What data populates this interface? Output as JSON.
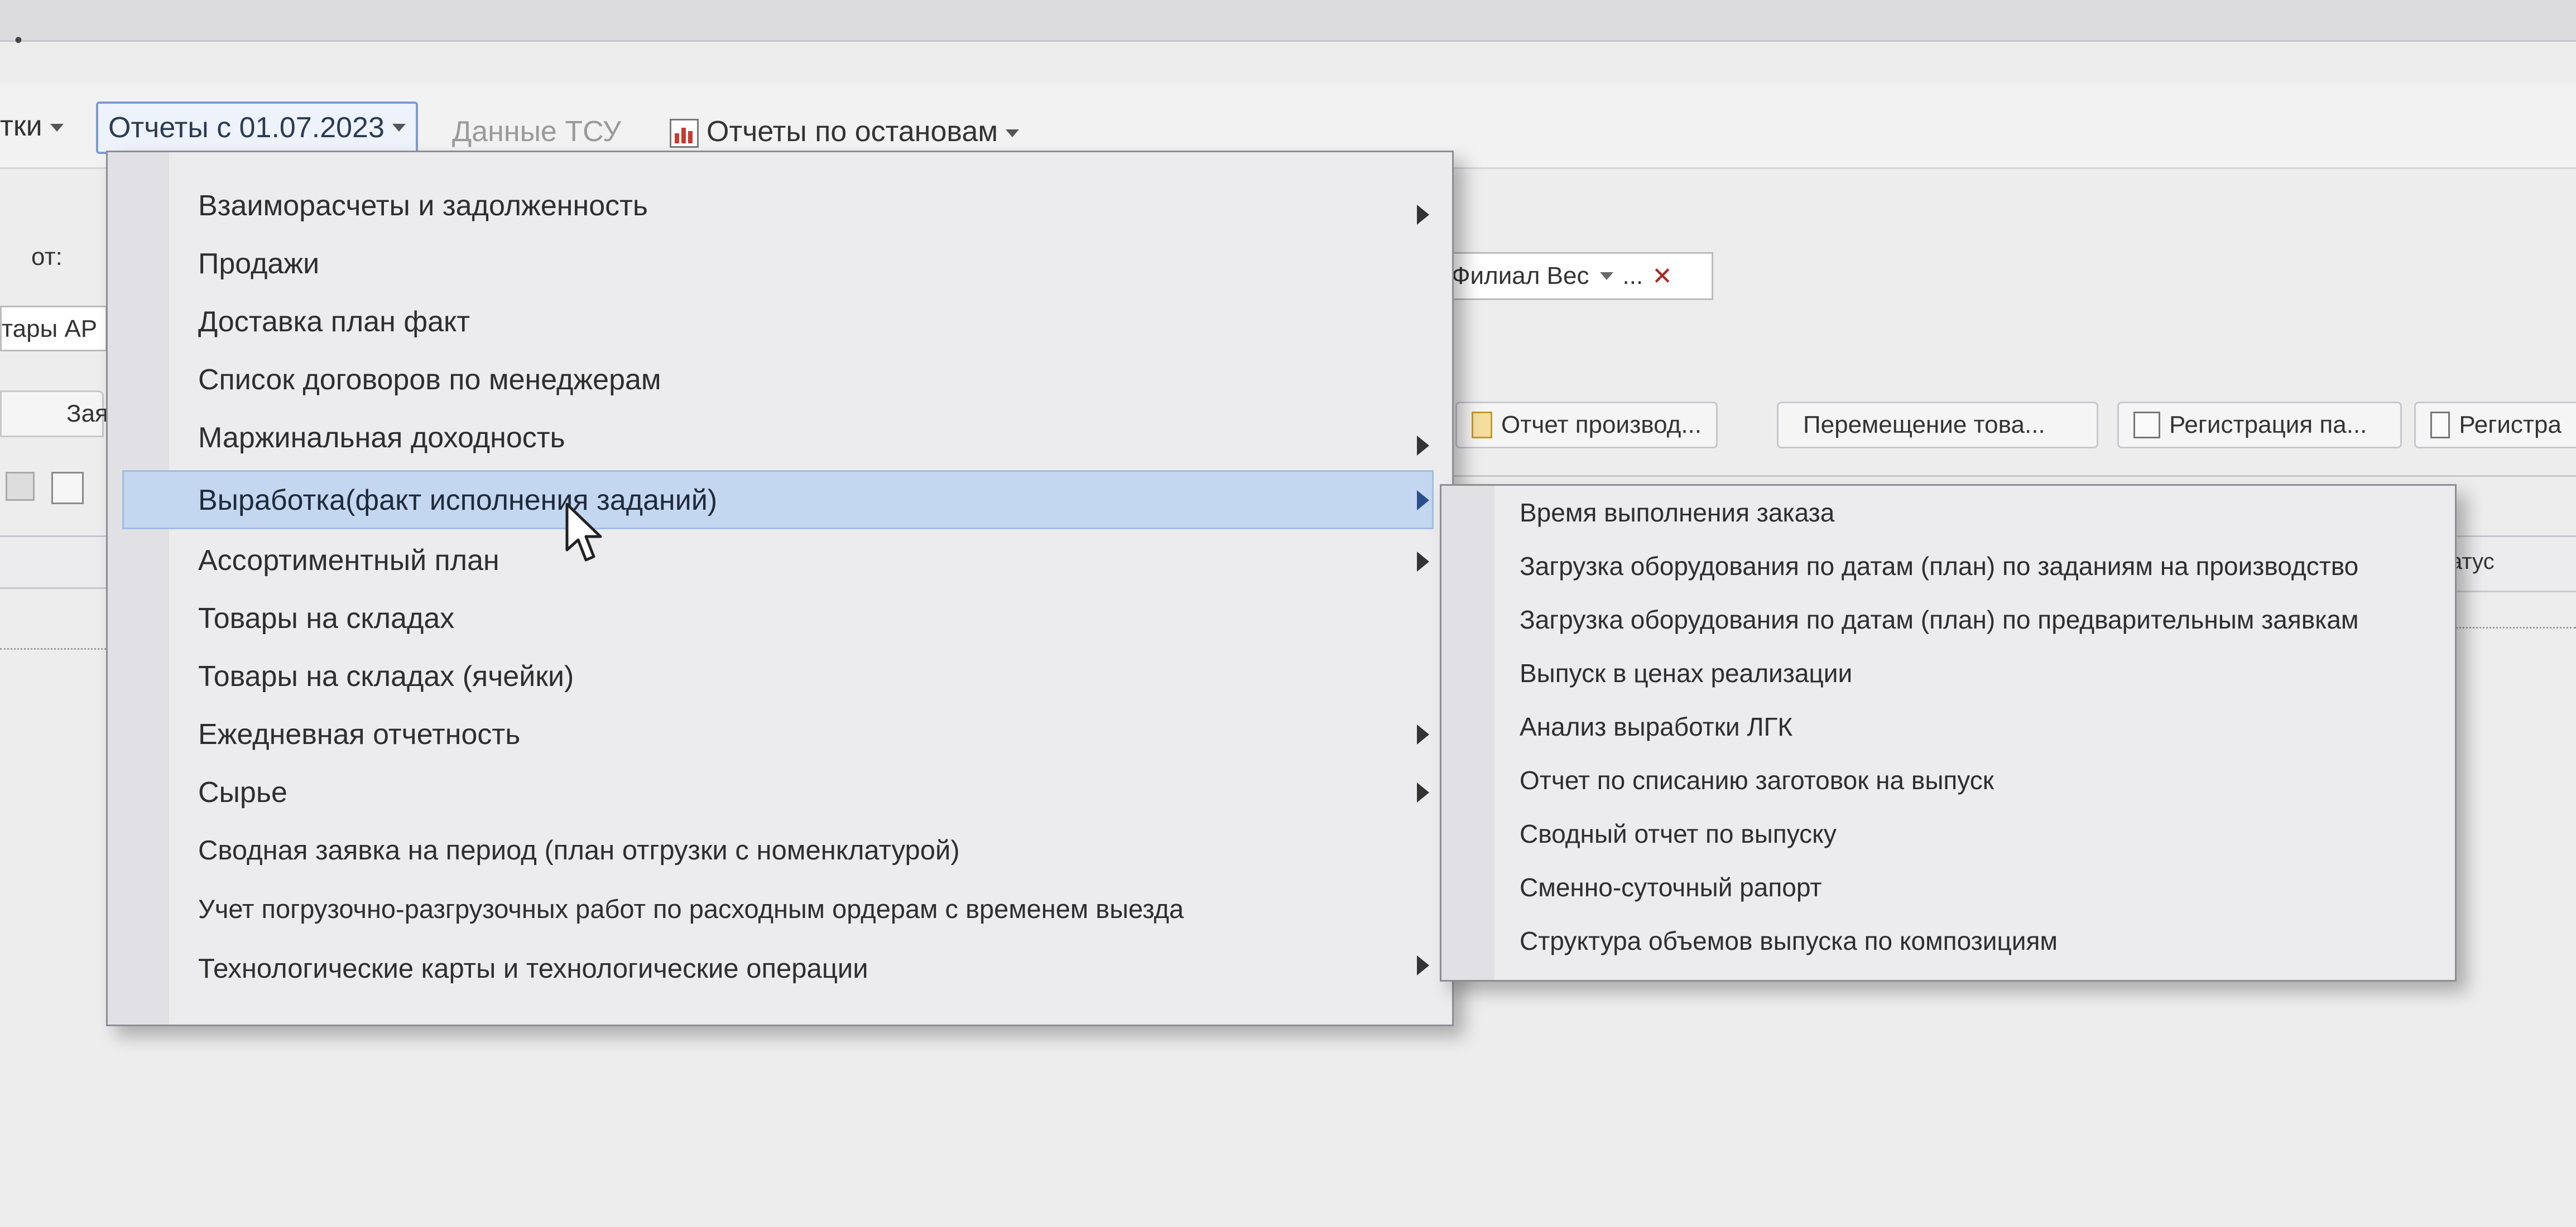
{
  "window": {
    "title_fragment": "•"
  },
  "toolbar": {
    "left_fragment": "тки",
    "active_menu": "Отчеты с 01.07.2023",
    "tsu_label": "Данные ТСУ",
    "stops_menu": "Отчеты по остановам"
  },
  "form": {
    "from_label": "от:",
    "goods_fragment": "тары АР",
    "tab_fragment": "Зая",
    "branch_value": "Филиал Вес",
    "branch_ellipsis": "...",
    "branch_clear": "✕",
    "status_header_fragment": "атус",
    "quick_buttons": [
      {
        "label": "Отчет производ..."
      },
      {
        "label": "Перемещение това..."
      },
      {
        "label": "Регистрация па..."
      },
      {
        "label": "Регистра"
      }
    ]
  },
  "menu": {
    "items": [
      {
        "label": "Взаиморасчеты и задолженность",
        "submenu": true
      },
      {
        "label": "Продажи",
        "submenu": false
      },
      {
        "label": "Доставка план факт",
        "submenu": false
      },
      {
        "label": "Список договоров по менеджерам",
        "submenu": false
      },
      {
        "label": "Маржинальная доходность",
        "submenu": true
      },
      {
        "label": "Выработка(факт исполнения заданий)",
        "submenu": true,
        "highlighted": true
      },
      {
        "label": "Ассортиментный план",
        "submenu": true
      },
      {
        "label": "Товары на складах",
        "submenu": false
      },
      {
        "label": "Товары на складах (ячейки)",
        "submenu": false
      },
      {
        "label": "Ежедневная отчетность",
        "submenu": true
      },
      {
        "label": "Сырье",
        "submenu": true
      },
      {
        "label": "Сводная заявка на период (план отгрузки с номенклатурой)",
        "submenu": false
      },
      {
        "label": "Учет погрузочно-разгрузочных работ по расходным ордерам с временем выезда",
        "submenu": false
      },
      {
        "label": "Технологические карты и технологические операции",
        "submenu": true
      }
    ]
  },
  "submenu": {
    "items": [
      {
        "label": "Время выполнения заказа"
      },
      {
        "label": "Загрузка оборудования по датам (план) по заданиям на производство"
      },
      {
        "label": "Загрузка оборудования по датам (план) по предварительным заявкам"
      },
      {
        "label": "Выпуск в ценах реализации"
      },
      {
        "label": "Анализ выработки ЛГК"
      },
      {
        "label": "Отчет по списанию заготовок на выпуск"
      },
      {
        "label": "Сводный отчет по выпуску"
      },
      {
        "label": "Сменно-суточный рапорт"
      },
      {
        "label": "Структура объемов выпуска по композициям"
      }
    ]
  },
  "colors": {
    "highlight": "#c4d7f0",
    "menu_bg": "#ececee",
    "active_menu_border": "#7c9bd0"
  }
}
